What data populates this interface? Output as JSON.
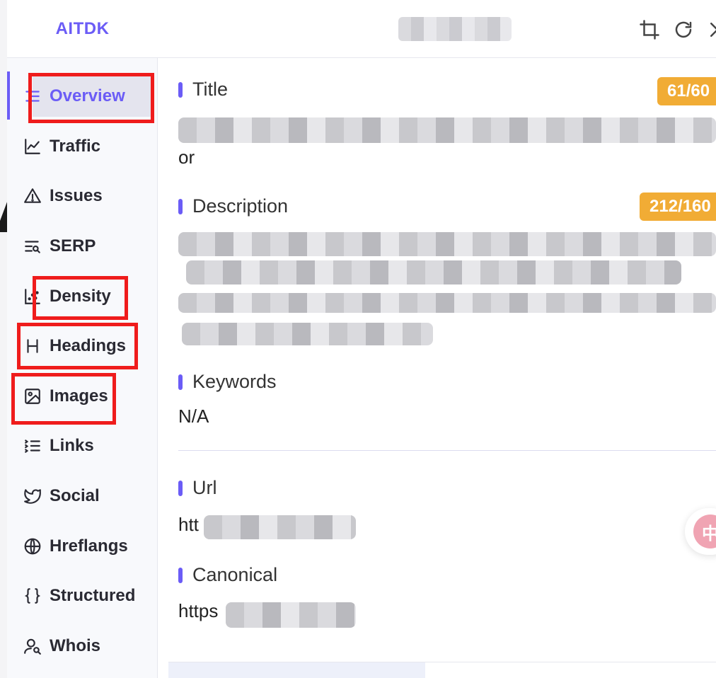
{
  "app": {
    "brand": "AITDK"
  },
  "sidebar": {
    "items": [
      {
        "label": "Overview",
        "icon": "list-lines-icon",
        "active": true
      },
      {
        "label": "Traffic",
        "icon": "line-chart-icon"
      },
      {
        "label": "Issues",
        "icon": "warning-triangle-icon"
      },
      {
        "label": "SERP",
        "icon": "list-search-icon"
      },
      {
        "label": "Density",
        "icon": "scatter-chart-icon"
      },
      {
        "label": "Headings",
        "icon": "heading-h-icon"
      },
      {
        "label": "Images",
        "icon": "image-icon"
      },
      {
        "label": "Links",
        "icon": "ordered-list-icon"
      },
      {
        "label": "Social",
        "icon": "twitter-bird-icon"
      },
      {
        "label": "Hreflangs",
        "icon": "globe-icon"
      },
      {
        "label": "Structured",
        "icon": "braces-icon"
      },
      {
        "label": "Whois",
        "icon": "user-search-icon"
      }
    ],
    "accent": "#6b5cf6"
  },
  "header": {
    "icons": [
      "crop-icon",
      "refresh-icon",
      "close-icon"
    ]
  },
  "main": {
    "title": {
      "label": "Title",
      "badge": "61/60",
      "value_tail": "or"
    },
    "description": {
      "label": "Description",
      "badge": "212/160"
    },
    "keywords": {
      "label": "Keywords",
      "value": "N/A"
    },
    "url": {
      "label": "Url",
      "value_prefix": "htt"
    },
    "canonical": {
      "label": "Canonical",
      "value_prefix": "https"
    },
    "badge_color": "#f1ac35"
  },
  "float_button": {
    "text": "中"
  }
}
